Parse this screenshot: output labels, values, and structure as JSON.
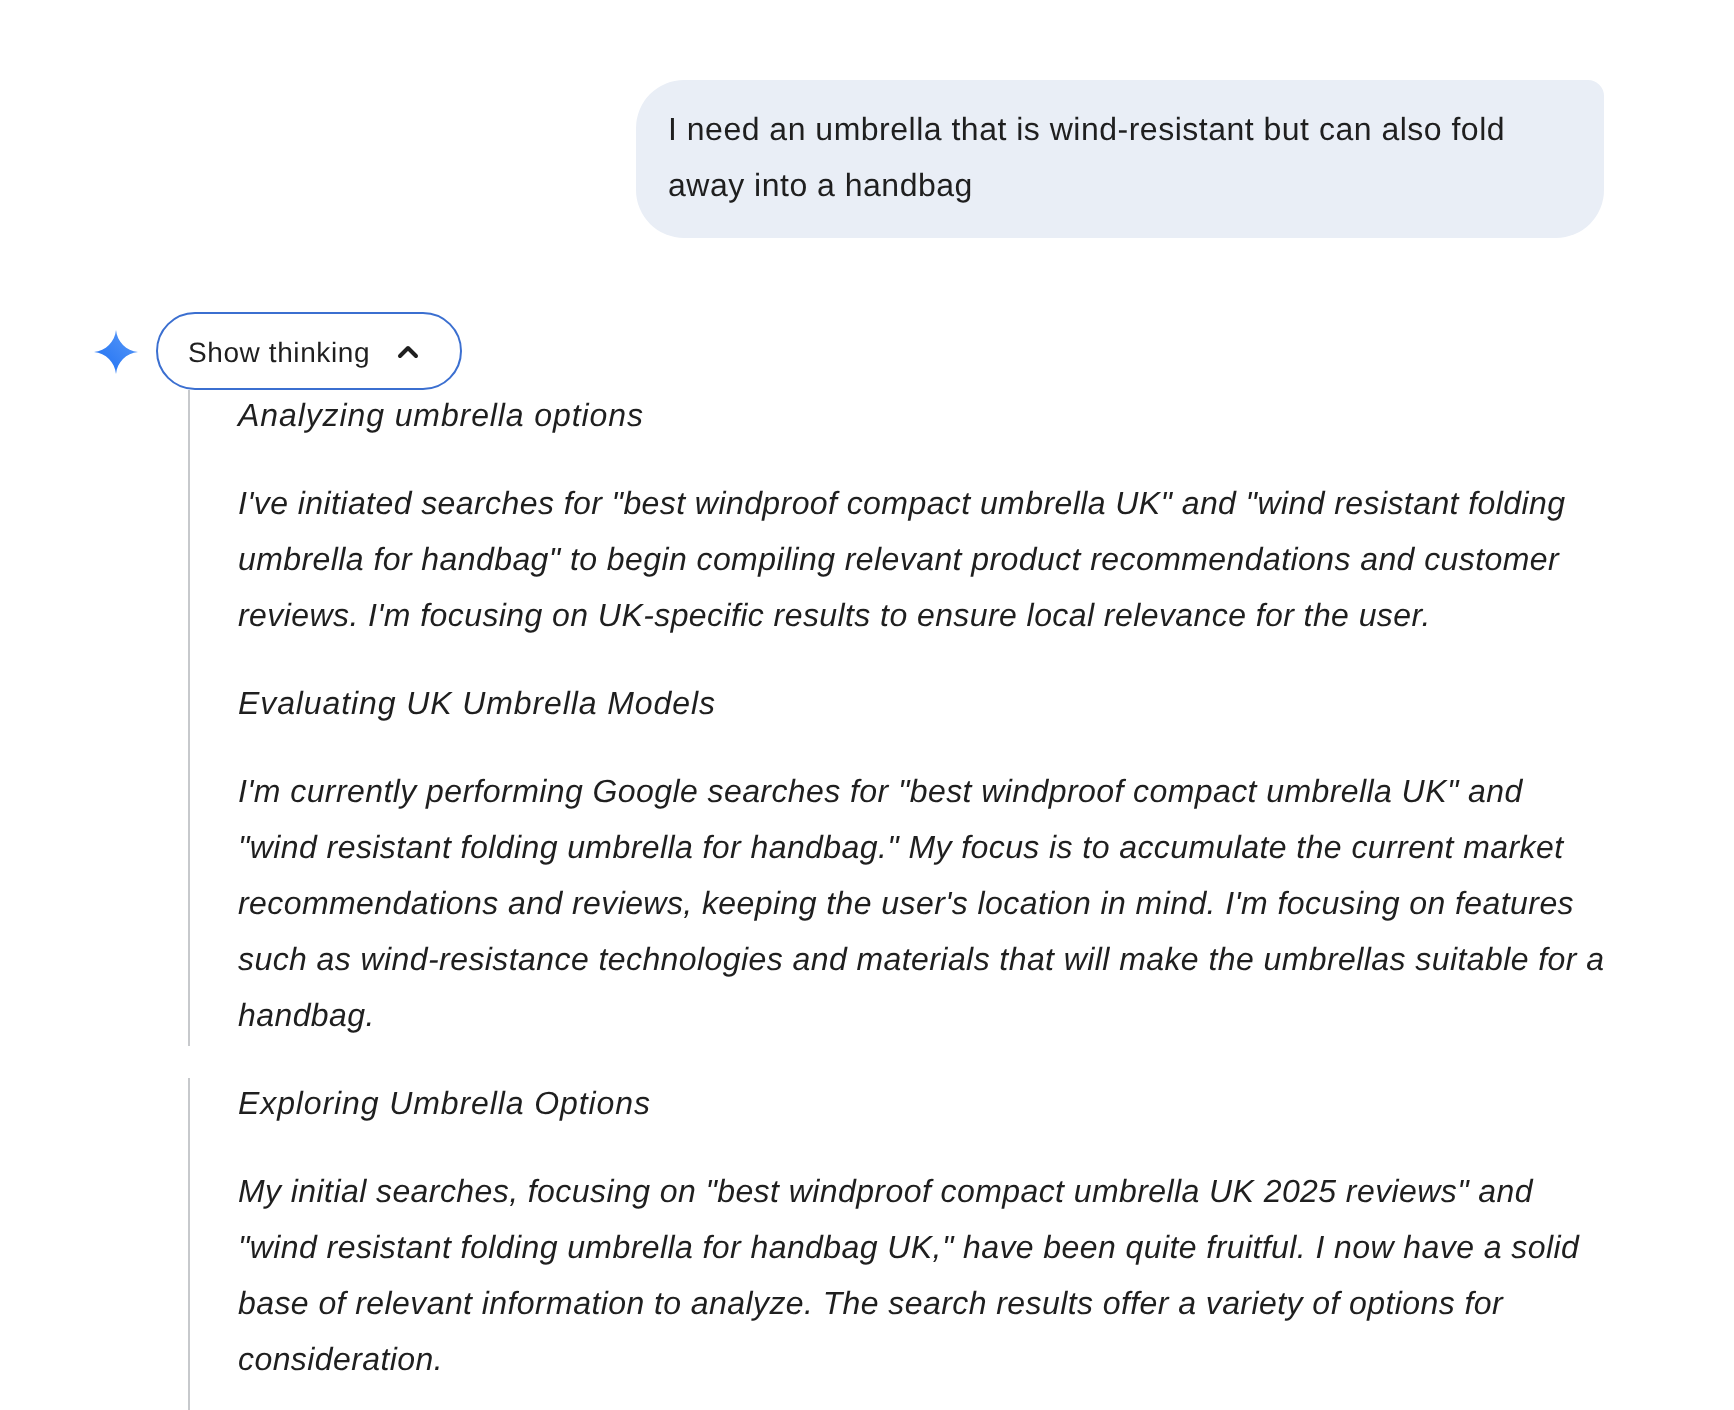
{
  "user_message": {
    "text": "I need an umbrella that is wind-resistant but can also fold away into a handbag"
  },
  "thinking_toggle": {
    "label": "Show thinking",
    "expanded": true
  },
  "thinking_blocks": [
    {
      "sections": [
        {
          "heading": "Analyzing umbrella options",
          "body": "I've initiated searches for \"best windproof compact umbrella UK\" and \"wind resistant folding umbrella for handbag\" to begin compiling relevant product recommendations and customer reviews. I'm focusing on UK-specific results to ensure local relevance for the user."
        },
        {
          "heading": "Evaluating UK Umbrella Models",
          "body": "I'm currently performing Google searches for \"best windproof compact umbrella UK\" and \"wind resistant folding umbrella for handbag.\" My focus is to accumulate the current market recommendations and reviews, keeping the user's location in mind. I'm focusing on features such as wind-resistance technologies and materials that will make the umbrellas suitable for a handbag."
        }
      ]
    },
    {
      "sections": [
        {
          "heading": "Exploring Umbrella Options",
          "body": "My initial searches, focusing on \"best windproof compact umbrella UK 2025 reviews\" and \"wind resistant folding umbrella for handbag UK,\" have been quite fruitful. I now have a solid base of relevant information to analyze. The search results offer a variety of options for consideration."
        }
      ]
    }
  ]
}
